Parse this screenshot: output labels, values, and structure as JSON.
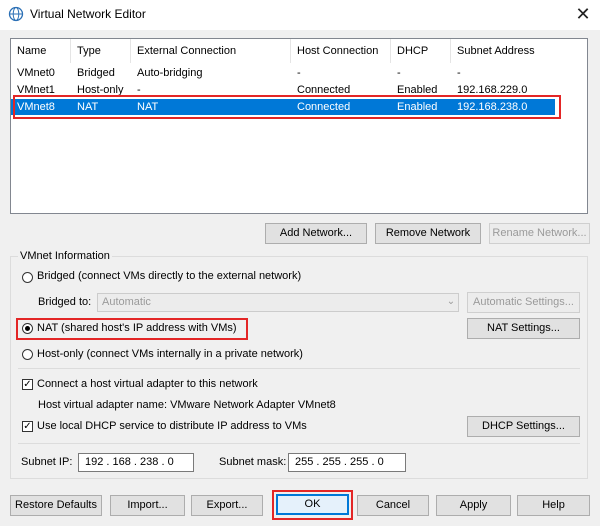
{
  "window": {
    "title": "Virtual Network Editor",
    "icon": "network-globe-icon",
    "close_glyph": "✕"
  },
  "table": {
    "columns": [
      "Name",
      "Type",
      "External Connection",
      "Host Connection",
      "DHCP",
      "Subnet Address"
    ],
    "rows": [
      {
        "name": "VMnet0",
        "type": "Bridged",
        "external": "Auto-bridging",
        "host": "-",
        "dhcp": "-",
        "subnet": "-"
      },
      {
        "name": "VMnet1",
        "type": "Host-only",
        "external": "-",
        "host": "Connected",
        "dhcp": "Enabled",
        "subnet": "192.168.229.0"
      },
      {
        "name": "VMnet8",
        "type": "NAT",
        "external": "NAT",
        "host": "Connected",
        "dhcp": "Enabled",
        "subnet": "192.168.238.0"
      }
    ],
    "selected_index": 2
  },
  "table_buttons": {
    "add": "Add Network...",
    "remove": "Remove Network",
    "rename": "Rename Network..."
  },
  "vmnet_info": {
    "legend": "VMnet Information",
    "bridged_label": "Bridged (connect VMs directly to the external network)",
    "bridged_to_label": "Bridged to:",
    "bridged_to_value": "Automatic",
    "automatic_settings": "Automatic Settings...",
    "nat_label": "NAT (shared host's IP address with VMs)",
    "nat_settings": "NAT Settings...",
    "hostonly_label": "Host-only (connect VMs internally in a private network)",
    "selected_mode": "nat",
    "connect_adapter_label": "Connect a host virtual adapter to this network",
    "connect_adapter_checked": true,
    "adapter_name_label": "Host virtual adapter name: VMware Network Adapter VMnet8",
    "dhcp_label": "Use local DHCP service to distribute IP address to VMs",
    "dhcp_checked": true,
    "dhcp_settings": "DHCP Settings...",
    "subnet_ip_label": "Subnet IP:",
    "subnet_ip": "192 . 168 . 238 .  0",
    "subnet_mask_label": "Subnet mask:",
    "subnet_mask": "255 . 255 . 255 .  0"
  },
  "footer_buttons": {
    "restore": "Restore Defaults",
    "import": "Import...",
    "export": "Export...",
    "ok": "OK",
    "cancel": "Cancel",
    "apply": "Apply",
    "help": "Help"
  },
  "colors": {
    "selection": "#0078d7",
    "highlight_outline": "#e32626"
  }
}
